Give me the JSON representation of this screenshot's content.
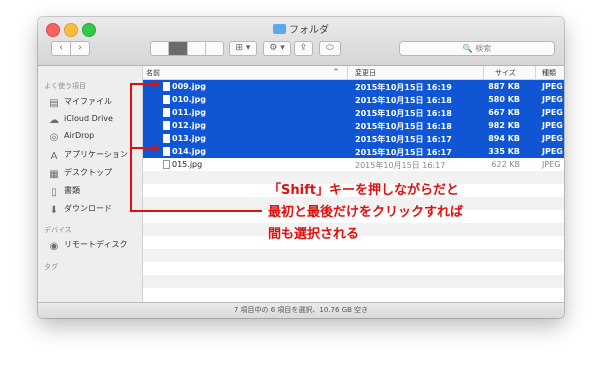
{
  "window": {
    "title": "フォルダ",
    "status": "7 項目中の 6 項目を選択、10.76 GB 空き"
  },
  "toolbar": {
    "back_glyph": "‹",
    "forward_glyph": "›",
    "arrange_glyph": "⊞ ▾",
    "action_glyph": "⚙ ▾",
    "share_glyph": "⇪",
    "tags_glyph": "⬭",
    "search_placeholder": "🔍 検索"
  },
  "sidebar": {
    "favorites_header": "よく使う項目",
    "devices_header": "デバイス",
    "tags_header": "タグ",
    "favorites": [
      {
        "label": "マイファイル",
        "icon": "all-my-files-icon",
        "glyph": "▤"
      },
      {
        "label": "iCloud Drive",
        "icon": "cloud-icon",
        "glyph": "☁"
      },
      {
        "label": "AirDrop",
        "icon": "airdrop-icon",
        "glyph": "◎"
      },
      {
        "label": "アプリケーション",
        "icon": "applications-icon",
        "glyph": "A"
      },
      {
        "label": "デスクトップ",
        "icon": "desktop-icon",
        "glyph": "▦"
      },
      {
        "label": "書類",
        "icon": "documents-icon",
        "glyph": "▯"
      },
      {
        "label": "ダウンロード",
        "icon": "downloads-icon",
        "glyph": "⬇"
      }
    ],
    "devices": [
      {
        "label": "リモートディスク",
        "icon": "remote-disc-icon",
        "glyph": "◉"
      }
    ]
  },
  "columns": {
    "name": "名前",
    "sort_indicator": "^",
    "date": "変更日",
    "size": "サイズ",
    "kind": "種類"
  },
  "files": [
    {
      "name": "009.jpg",
      "date": "2015年10月15日 16:19",
      "size": "887 KB",
      "kind": "JPEG",
      "selected": true
    },
    {
      "name": "010.jpg",
      "date": "2015年10月15日 16:18",
      "size": "580 KB",
      "kind": "JPEG",
      "selected": true
    },
    {
      "name": "011.jpg",
      "date": "2015年10月15日 16:18",
      "size": "667 KB",
      "kind": "JPEG",
      "selected": true
    },
    {
      "name": "012.jpg",
      "date": "2015年10月15日 16:18",
      "size": "982 KB",
      "kind": "JPEG",
      "selected": true
    },
    {
      "name": "013.jpg",
      "date": "2015年10月15日 16:17",
      "size": "894 KB",
      "kind": "JPEG",
      "selected": true
    },
    {
      "name": "014.jpg",
      "date": "2015年10月15日 16:17",
      "size": "335 KB",
      "kind": "JPEG",
      "selected": true
    },
    {
      "name": "015.jpg",
      "date": "2015年10月15日 16:17",
      "size": "622 KB",
      "kind": "JPEG",
      "selected": false
    }
  ],
  "annotation": {
    "lines": [
      "「Shift」キーを押しながらだと",
      "最初と最後だけをクリックすれば",
      "間も選択される"
    ],
    "color": "#e01010"
  },
  "colors": {
    "selection": "#0f55d4"
  }
}
